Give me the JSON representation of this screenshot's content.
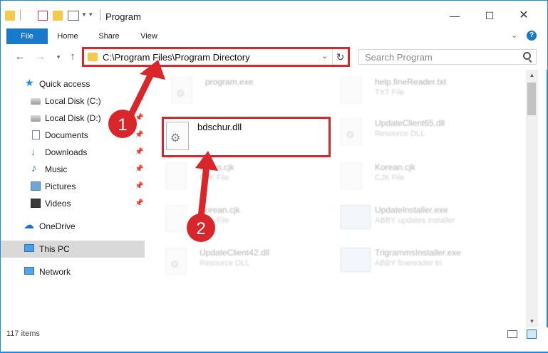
{
  "window": {
    "title": "Program",
    "minimize_glyph": "—",
    "maximize_glyph": "☐",
    "close_glyph": "✕"
  },
  "ribbon": {
    "tabs": [
      "File",
      "Home",
      "Share",
      "View"
    ],
    "help_glyph": "?"
  },
  "address_bar": {
    "path": "C:\\Program Files\\Program Directory",
    "refresh_glyph": "↻"
  },
  "search": {
    "placeholder": "Search Program"
  },
  "sidebar": {
    "items": [
      {
        "label": "Quick access",
        "icon": "star-icon"
      },
      {
        "label": "Local Disk (C:)",
        "icon": "disk-icon"
      },
      {
        "label": "Local Disk (D:)",
        "icon": "disk-icon"
      },
      {
        "label": "Documents",
        "icon": "document-icon"
      },
      {
        "label": "Downloads",
        "icon": "download-icon"
      },
      {
        "label": "Music",
        "icon": "music-icon"
      },
      {
        "label": "Pictures",
        "icon": "pictures-icon"
      },
      {
        "label": "Videos",
        "icon": "video-icon"
      },
      {
        "label": "OneDrive",
        "icon": "cloud-icon"
      },
      {
        "label": "This PC",
        "icon": "computer-icon"
      },
      {
        "label": "Network",
        "icon": "network-icon"
      }
    ],
    "selected": "This PC"
  },
  "files": {
    "highlighted": {
      "name": "bdschur.dll"
    },
    "items": [
      {
        "name": "program.exe",
        "desc": ""
      },
      {
        "name": "help.fineReader.txt",
        "desc": "TXT File"
      },
      {
        "name": "UpdateClient65.dll",
        "desc": "Resource DLL"
      },
      {
        "name": "Ecom.cjk",
        "desc": "CJK File"
      },
      {
        "name": "Korean.cjk",
        "desc": "CJK File"
      },
      {
        "name": "Korean.cjk",
        "desc": "CJK File"
      },
      {
        "name": "UpdateInstaller.exe",
        "desc": "ABBY updates installer"
      },
      {
        "name": "UpdateClient42.dll",
        "desc": "Resource DLL"
      },
      {
        "name": "TrigrammsInstaller.exe",
        "desc": "ABBY finereader tri"
      }
    ]
  },
  "annotations": {
    "step1": "1",
    "step2": "2",
    "color": "#d9262b"
  },
  "status": {
    "item_count": "117 items"
  }
}
